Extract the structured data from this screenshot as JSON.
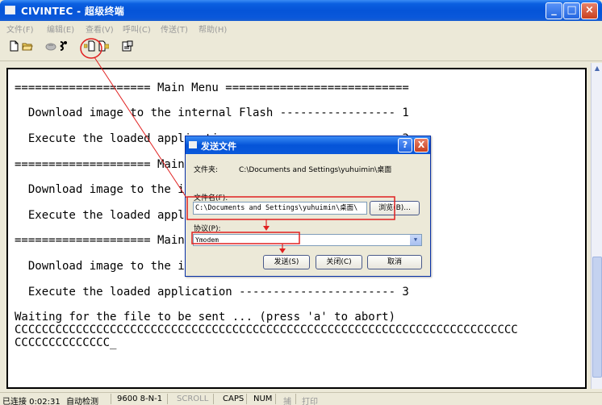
{
  "window": {
    "title": "CIVINTEC - 超级终端"
  },
  "menu": [
    {
      "label": "文件(F)"
    },
    {
      "label": "编辑(E)"
    },
    {
      "label": "查看(V)"
    },
    {
      "label": "呼叫(C)"
    },
    {
      "label": "传送(T)"
    },
    {
      "label": "帮助(H)"
    }
  ],
  "toolbar": {
    "icons": [
      "new-icon",
      "open-icon",
      "disconnect-icon",
      "connect-icon",
      "send-file-icon",
      "receive-file-icon",
      "properties-icon"
    ]
  },
  "terminal": {
    "lines": [
      "",
      "==================== Main Menu ===========================",
      "",
      "  Download image to the internal Flash ----------------- 1",
      "",
      "  Execute the loaded application ----------------------- 3",
      "",
      "==================== Main Menu ===========================",
      "",
      "  Download image to the internal Flash ----------------- 1",
      "",
      "  Execute the loaded application ----------------------- 3",
      "",
      "==================== Main Menu ===========================",
      "",
      "  Download image to the internal Flash ----------------- 1",
      "",
      "  Execute the loaded application ----------------------- 3",
      "",
      "Waiting for the file to be sent ... (press 'a' to abort)",
      "CCCCCCCCCCCCCCCCCCCCCCCCCCCCCCCCCCCCCCCCCCCCCCCCCCCCCCCCCCCCCCCCCCCCCCCCCC",
      "CCCCCCCCCCCCCC_"
    ]
  },
  "dialog": {
    "title": "发送文件",
    "folder_label": "文件夹:",
    "folder_value": "C:\\Documents and Settings\\yuhuimin\\桌面",
    "filename_label": "文件名(F):",
    "filename_value": "C:\\Documents and Settings\\yuhuimin\\桌面\\",
    "browse_label": "浏览(B)...",
    "protocol_label": "协议(P):",
    "protocol_value": "Ymodem",
    "send_label": "发送(S)",
    "close_label": "关闭(C)",
    "cancel_label": "取消",
    "help_label": "?",
    "close_x": "X"
  },
  "status": {
    "connected": "已连接 0:02:31",
    "detect": "自动检测",
    "params": "9600 8-N-1",
    "scroll": "SCROLL",
    "caps": "CAPS",
    "num": "NUM",
    "capture": "捕",
    "print": "打印"
  },
  "colors": {
    "annotation": "#e02020"
  }
}
